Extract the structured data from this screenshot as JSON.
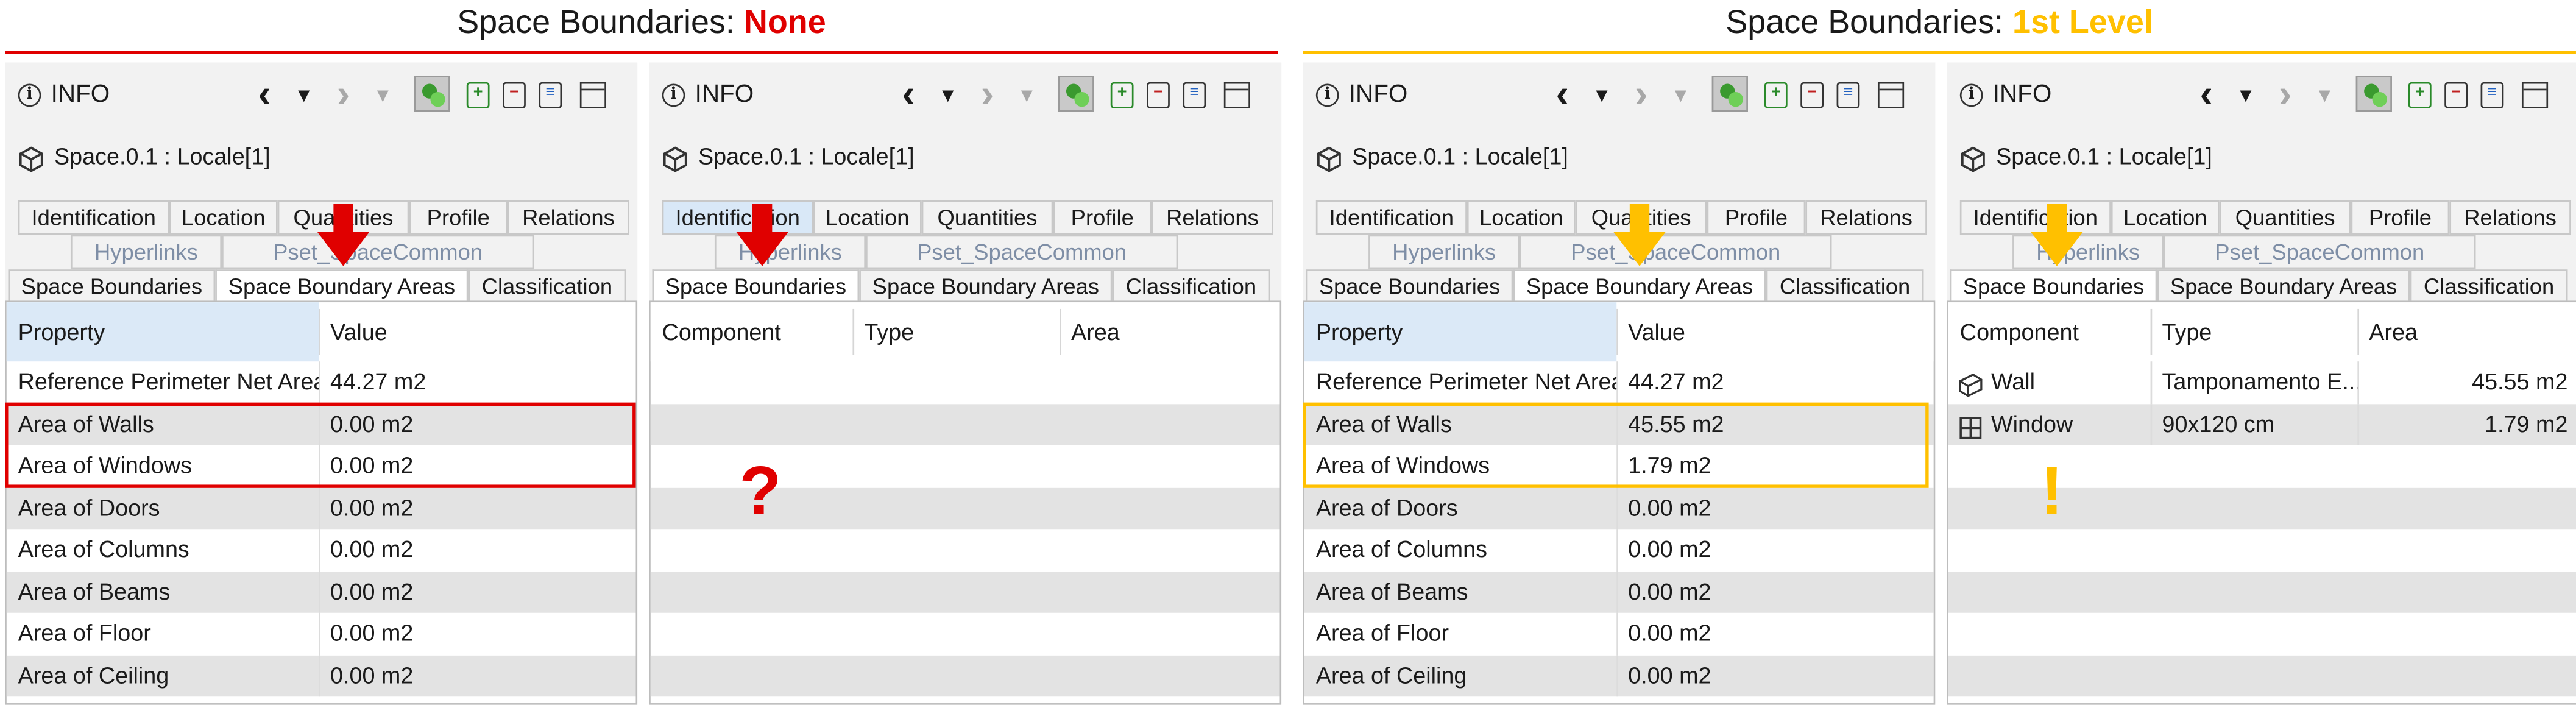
{
  "colors": {
    "red": "#e00000",
    "orange": "#ffc000",
    "tab_link": "#7e8ea6",
    "selected_header": "#dbe9f7",
    "row_alt": "#e3e3e3"
  },
  "headings": {
    "left": {
      "prefix": "Space Boundaries: ",
      "value": "None"
    },
    "right": {
      "prefix": "Space Boundaries: ",
      "value": "1st Level"
    }
  },
  "panel_common": {
    "info_label": "INFO",
    "object_title": "Space.0.1 : Locale[1]",
    "icons": [
      "info-icon",
      "back-icon",
      "dropdown-icon",
      "forward-icon",
      "dropdown-icon",
      "show-3d-icon",
      "add-icon",
      "remove-icon",
      "list-icon",
      "window-icon",
      "cube-icon"
    ],
    "tabs_row1": [
      "Identification",
      "Location",
      "Quantities",
      "Profile",
      "Relations"
    ],
    "tabs_row2": [
      "Hyperlinks",
      "Pset_SpaceCommon"
    ],
    "tabs_row3": [
      "Space Boundaries",
      "Space Boundary Areas",
      "Classification"
    ]
  },
  "areas_table": {
    "columns": [
      "Property",
      "Value"
    ],
    "property_names": [
      "Reference Perimeter Net Area",
      "Area of Walls",
      "Area of Windows",
      "Area of Doors",
      "Area of Columns",
      "Area of Beams",
      "Area of Floor",
      "Area of Ceiling"
    ],
    "values_none": [
      "44.27 m2",
      "0.00 m2",
      "0.00 m2",
      "0.00 m2",
      "0.00 m2",
      "0.00 m2",
      "0.00 m2",
      "0.00 m2"
    ],
    "values_first_level": [
      "44.27 m2",
      "45.55 m2",
      "1.79 m2",
      "0.00 m2",
      "0.00 m2",
      "0.00 m2",
      "0.00 m2",
      "0.00 m2"
    ]
  },
  "boundaries_table": {
    "columns": [
      "Component",
      "Type",
      "Area"
    ],
    "rows_none": [],
    "rows_first_level": [
      {
        "component": "Wall",
        "icon": "wall-icon",
        "type": "Tamponamento E...",
        "area": "45.55 m2"
      },
      {
        "component": "Window",
        "icon": "window-grid-icon",
        "type": "90x120 cm",
        "area": "1.79 m2"
      }
    ]
  },
  "annotations": {
    "question": "?",
    "exclamation": "!"
  }
}
